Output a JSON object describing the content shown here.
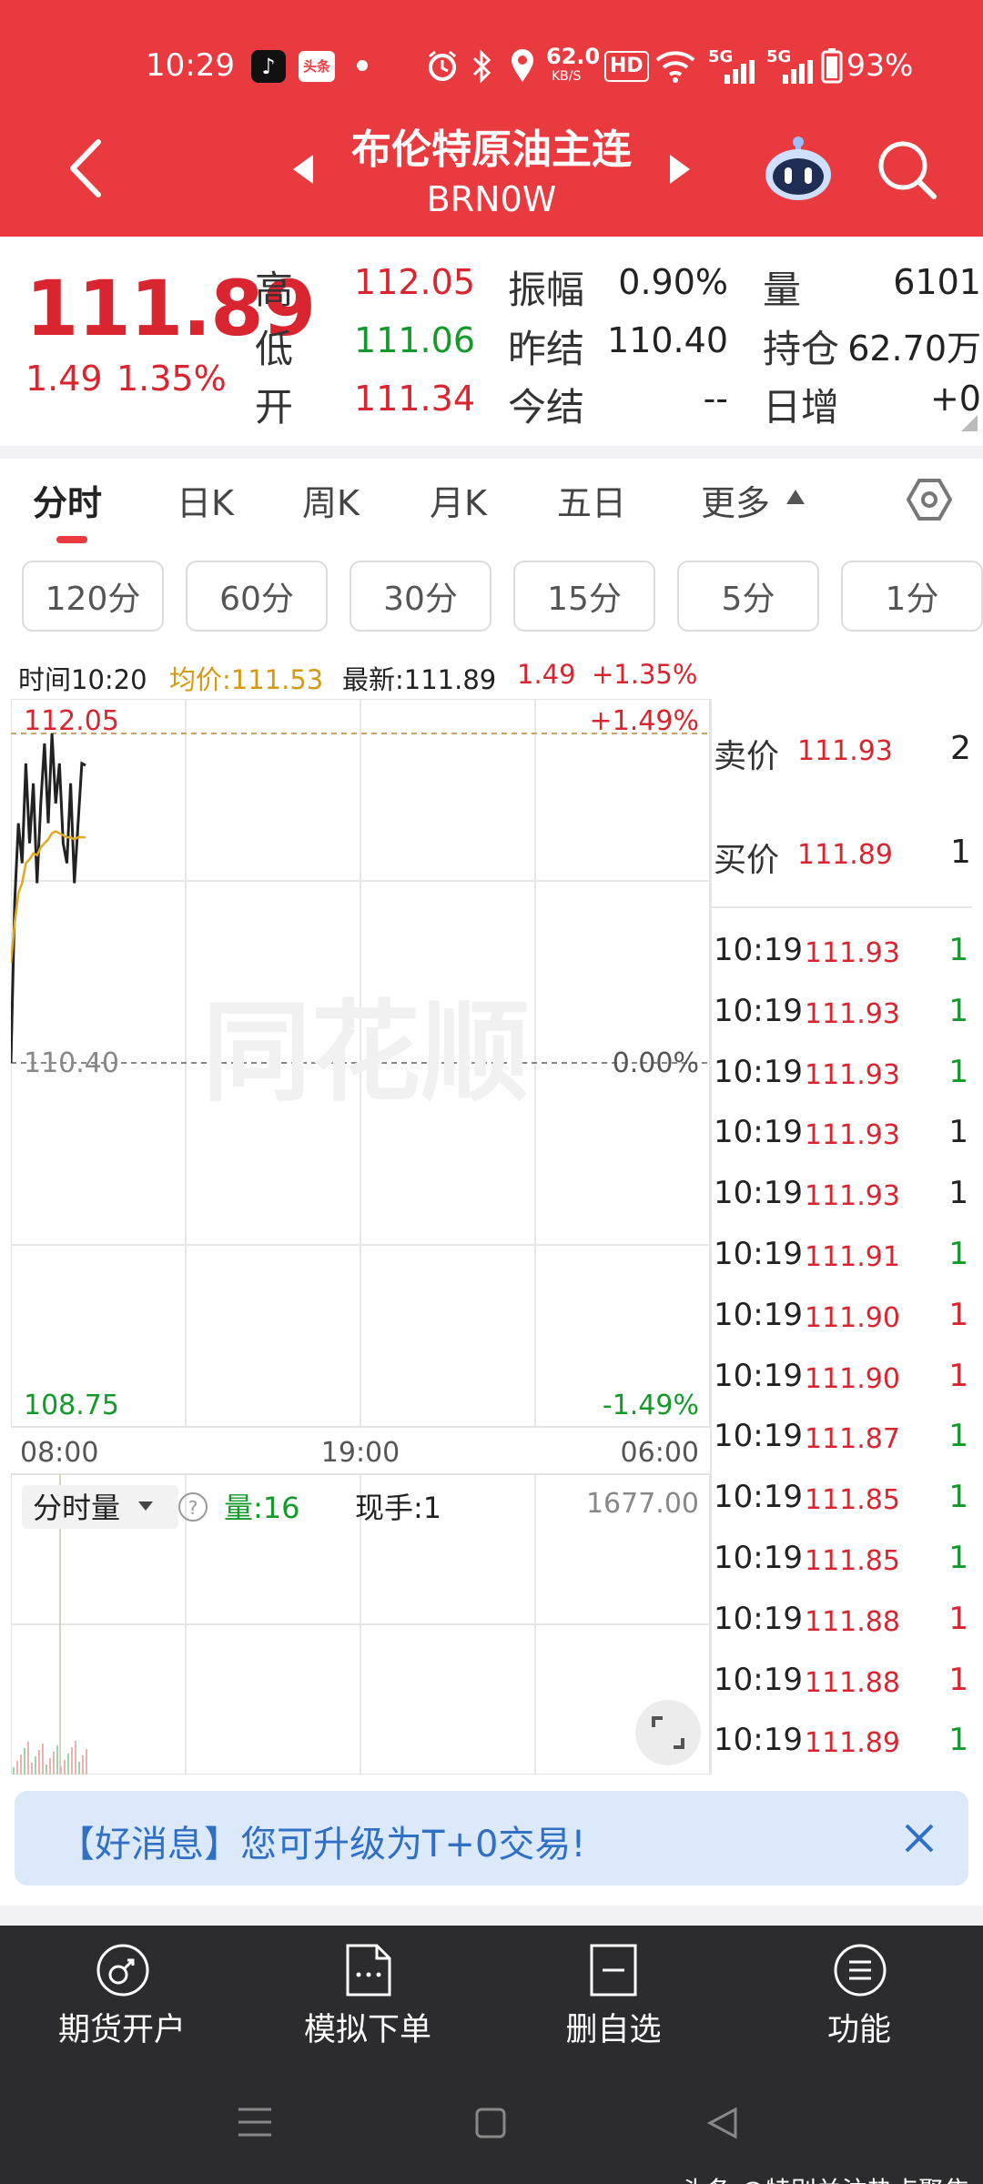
{
  "status_bar": {
    "time": "10:29",
    "speed_value": "62.0",
    "speed_unit": "KB/S",
    "net_badge_1": "5G",
    "net_badge_2": "5G",
    "battery": "93%",
    "hd_badge": "HD",
    "app_badge": "头条"
  },
  "header": {
    "title": "布伦特原油主连",
    "code": "BRN0W"
  },
  "quote": {
    "price": "111.89",
    "change": "1.49",
    "change_pct": "1.35%",
    "fields": [
      {
        "label": "高",
        "value": "112.05"
      },
      {
        "label": "低",
        "value": "111.06"
      },
      {
        "label": "开",
        "value": "111.34"
      },
      {
        "label": "振幅",
        "value": "0.90%"
      },
      {
        "label": "昨结",
        "value": "110.40"
      },
      {
        "label": "今结",
        "value": "--"
      },
      {
        "label": "量",
        "value": "6101"
      },
      {
        "label": "持仓",
        "value": "62.70万"
      },
      {
        "label": "日增",
        "value": "+0"
      }
    ]
  },
  "tabs": [
    "分时",
    "日K",
    "周K",
    "月K",
    "五日",
    "更多"
  ],
  "intervals": [
    "120分",
    "60分",
    "30分",
    "15分",
    "5分",
    "1分"
  ],
  "info_bar": {
    "time": "时间10:20",
    "avg": "均价:111.53",
    "latest": "最新:111.89",
    "change": "1.49",
    "change_pct": "+1.35%"
  },
  "chart": {
    "high_label": "112.05",
    "high_pct": "+1.49%",
    "mid_label": "110.40",
    "mid_pct": "0.00%",
    "low_label": "108.75",
    "low_pct": "-1.49%",
    "x_labels": [
      "08:00",
      "19:00",
      "06:00"
    ],
    "volume_selector": "分时量",
    "volume_label": "量:16",
    "hand_label": "现手:1",
    "volume_max": "1677.00",
    "watermark": "同花顺"
  },
  "chart_data": {
    "type": "line",
    "title": "",
    "ylim": [
      108.75,
      112.05
    ],
    "ylabels": [
      "112.05",
      "110.40",
      "108.75"
    ],
    "xlabels": [
      "08:00",
      "19:00",
      "06:00"
    ],
    "series": [
      {
        "name": "最新",
        "values": [
          110.4,
          111.2,
          111.6,
          111.4,
          111.9,
          111.5,
          111.8,
          111.3,
          111.7,
          112.0,
          111.6,
          112.05,
          111.7,
          111.9,
          111.5,
          111.4,
          111.8,
          111.3,
          111.6,
          111.9,
          111.89
        ]
      },
      {
        "name": "均价",
        "values": [
          110.9,
          111.1,
          111.25,
          111.3,
          111.4,
          111.42,
          111.45,
          111.44,
          111.48,
          111.5,
          111.52,
          111.55,
          111.56,
          111.55,
          111.54,
          111.53,
          111.53,
          111.52,
          111.53,
          111.53,
          111.53
        ]
      }
    ]
  },
  "order_book": {
    "sell_label": "卖价",
    "sell_price": "111.93",
    "sell_qty": "2",
    "buy_label": "买价",
    "buy_price": "111.89",
    "buy_qty": "1"
  },
  "trades": [
    {
      "time": "10:19",
      "price": "111.93",
      "qty": "1",
      "dir": "up"
    },
    {
      "time": "10:19",
      "price": "111.93",
      "qty": "1",
      "dir": "up"
    },
    {
      "time": "10:19",
      "price": "111.93",
      "qty": "1",
      "dir": "up"
    },
    {
      "time": "10:19",
      "price": "111.93",
      "qty": "1",
      "dir": "flat"
    },
    {
      "time": "10:19",
      "price": "111.93",
      "qty": "1",
      "dir": "flat"
    },
    {
      "time": "10:19",
      "price": "111.91",
      "qty": "1",
      "dir": "up"
    },
    {
      "time": "10:19",
      "price": "111.90",
      "qty": "1",
      "dir": "down"
    },
    {
      "time": "10:19",
      "price": "111.90",
      "qty": "1",
      "dir": "down"
    },
    {
      "time": "10:19",
      "price": "111.87",
      "qty": "1",
      "dir": "up"
    },
    {
      "time": "10:19",
      "price": "111.85",
      "qty": "1",
      "dir": "up"
    },
    {
      "time": "10:19",
      "price": "111.85",
      "qty": "1",
      "dir": "up"
    },
    {
      "time": "10:19",
      "price": "111.88",
      "qty": "1",
      "dir": "down"
    },
    {
      "time": "10:19",
      "price": "111.88",
      "qty": "1",
      "dir": "down"
    },
    {
      "time": "10:19",
      "price": "111.89",
      "qty": "1",
      "dir": "up"
    }
  ],
  "banner": {
    "text": "【好消息】您可升级为T+0交易!"
  },
  "bottom_nav": [
    "期货开户",
    "模拟下单",
    "删自选",
    "功能"
  ],
  "footer_watermark": "头条 @特别关注热点聚焦"
}
